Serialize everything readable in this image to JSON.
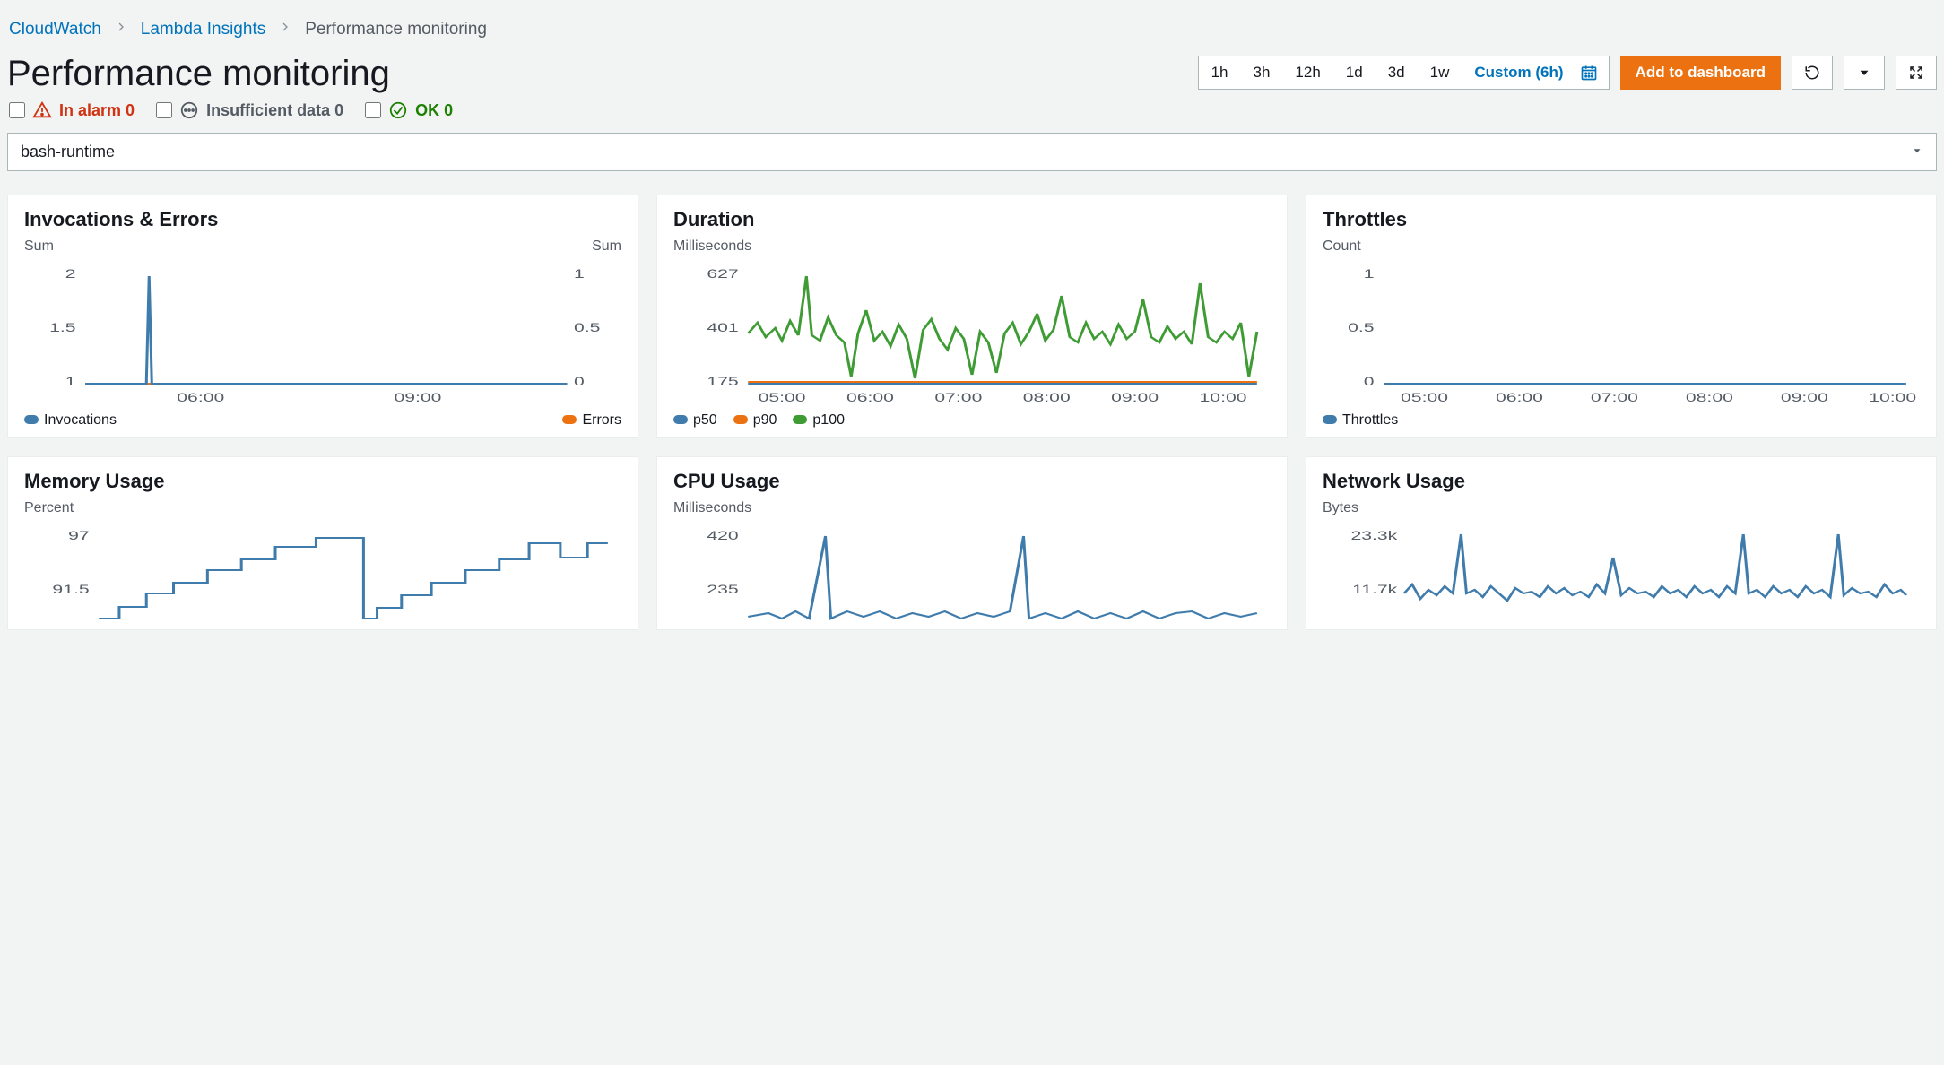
{
  "breadcrumb": {
    "items": [
      "CloudWatch",
      "Lambda Insights",
      "Performance monitoring"
    ]
  },
  "title": "Performance monitoring",
  "time_range": {
    "options": [
      "1h",
      "3h",
      "12h",
      "1d",
      "3d",
      "1w"
    ],
    "custom_label": "Custom (6h)",
    "selected_label": "Custom (6h)"
  },
  "actions": {
    "add_to_dashboard": "Add to dashboard"
  },
  "status": {
    "in_alarm_label": "In alarm",
    "in_alarm_count": "0",
    "insufficient_label": "Insufficient data",
    "insufficient_count": "0",
    "ok_label": "OK",
    "ok_count": "0"
  },
  "function_select": {
    "value": "bash-runtime"
  },
  "widgets": [
    {
      "id": "invocations",
      "title": "Invocations & Errors",
      "y_left_label": "Sum",
      "y_right_label": "Sum",
      "legend": [
        {
          "label": "Invocations",
          "color": "#3f7cac"
        },
        {
          "label": "Errors",
          "color": "#ec7211"
        }
      ]
    },
    {
      "id": "duration",
      "title": "Duration",
      "y_left_label": "Milliseconds",
      "legend": [
        {
          "label": "p50",
          "color": "#3f7cac"
        },
        {
          "label": "p90",
          "color": "#ec7211"
        },
        {
          "label": "p100",
          "color": "#3f9c35"
        }
      ]
    },
    {
      "id": "throttles",
      "title": "Throttles",
      "y_left_label": "Count",
      "legend": [
        {
          "label": "Throttles",
          "color": "#3f7cac"
        }
      ]
    },
    {
      "id": "memory",
      "title": "Memory Usage",
      "y_left_label": "Percent"
    },
    {
      "id": "cpu",
      "title": "CPU Usage",
      "y_left_label": "Milliseconds"
    },
    {
      "id": "network",
      "title": "Network Usage",
      "y_left_label": "Bytes"
    }
  ],
  "chart_data": [
    {
      "id": "invocations",
      "type": "line",
      "x": [
        "06:00",
        "09:00"
      ],
      "x_ticks": [
        "06:00",
        "09:00"
      ],
      "y_ticks_left": [
        "1",
        "1.5",
        "2"
      ],
      "y_ticks_right": [
        "0",
        "0.5",
        "1"
      ],
      "ylim_left": [
        1,
        2
      ],
      "ylim_right": [
        0,
        1
      ],
      "series": [
        {
          "name": "Invocations",
          "color": "#3f7cac",
          "note": "constant 1 with single spike to 2 near 05:40",
          "values": [
            1,
            1,
            2,
            1,
            1,
            1,
            1,
            1,
            1,
            1,
            1,
            1,
            1,
            1,
            1,
            1,
            1,
            1
          ]
        },
        {
          "name": "Errors",
          "color": "#ec7211",
          "note": "constant 0",
          "values": [
            0,
            0,
            0,
            0,
            0,
            0,
            0,
            0,
            0,
            0,
            0,
            0,
            0,
            0,
            0,
            0,
            0,
            0
          ]
        }
      ]
    },
    {
      "id": "duration",
      "type": "line",
      "x_ticks": [
        "05:00",
        "06:00",
        "07:00",
        "08:00",
        "09:00",
        "10:00"
      ],
      "y_ticks_left": [
        "175",
        "401",
        "627"
      ],
      "ylim_left": [
        175,
        627
      ],
      "series": [
        {
          "name": "p50",
          "color": "#3f7cac",
          "note": "flat near 175"
        },
        {
          "name": "p90",
          "color": "#ec7211",
          "note": "flat near 175"
        },
        {
          "name": "p100",
          "color": "#3f9c35",
          "note": "noisy around 401 with spikes to 627 and dips toward 175"
        }
      ]
    },
    {
      "id": "throttles",
      "type": "line",
      "x_ticks": [
        "05:00",
        "06:00",
        "07:00",
        "08:00",
        "09:00",
        "10:00"
      ],
      "y_ticks_left": [
        "0",
        "0.5",
        "1"
      ],
      "ylim_left": [
        0,
        1
      ],
      "series": [
        {
          "name": "Throttles",
          "color": "#3f7cac",
          "note": "constant 0",
          "values": [
            0,
            0,
            0,
            0,
            0,
            0
          ]
        }
      ]
    },
    {
      "id": "memory",
      "type": "line",
      "y_ticks_left": [
        "91.5",
        "97"
      ],
      "ylim_left": [
        86,
        97
      ],
      "series": [
        {
          "name": "Memory",
          "color": "#3f7cac",
          "note": "stair-step rises from ~88 to 97 then drops; repeats"
        }
      ]
    },
    {
      "id": "cpu",
      "type": "line",
      "y_ticks_left": [
        "235",
        "420"
      ],
      "ylim_left": [
        50,
        420
      ],
      "series": [
        {
          "name": "CPU",
          "color": "#3f7cac",
          "note": "low baseline ~60 with periodic spikes to ~420"
        }
      ]
    },
    {
      "id": "network",
      "type": "line",
      "y_ticks_left": [
        "11.7k",
        "23.3k"
      ],
      "ylim_left": [
        0,
        23300
      ],
      "series": [
        {
          "name": "Network",
          "color": "#3f7cac",
          "note": "noisy around 11.7k with spikes to 23.3k"
        }
      ]
    }
  ]
}
